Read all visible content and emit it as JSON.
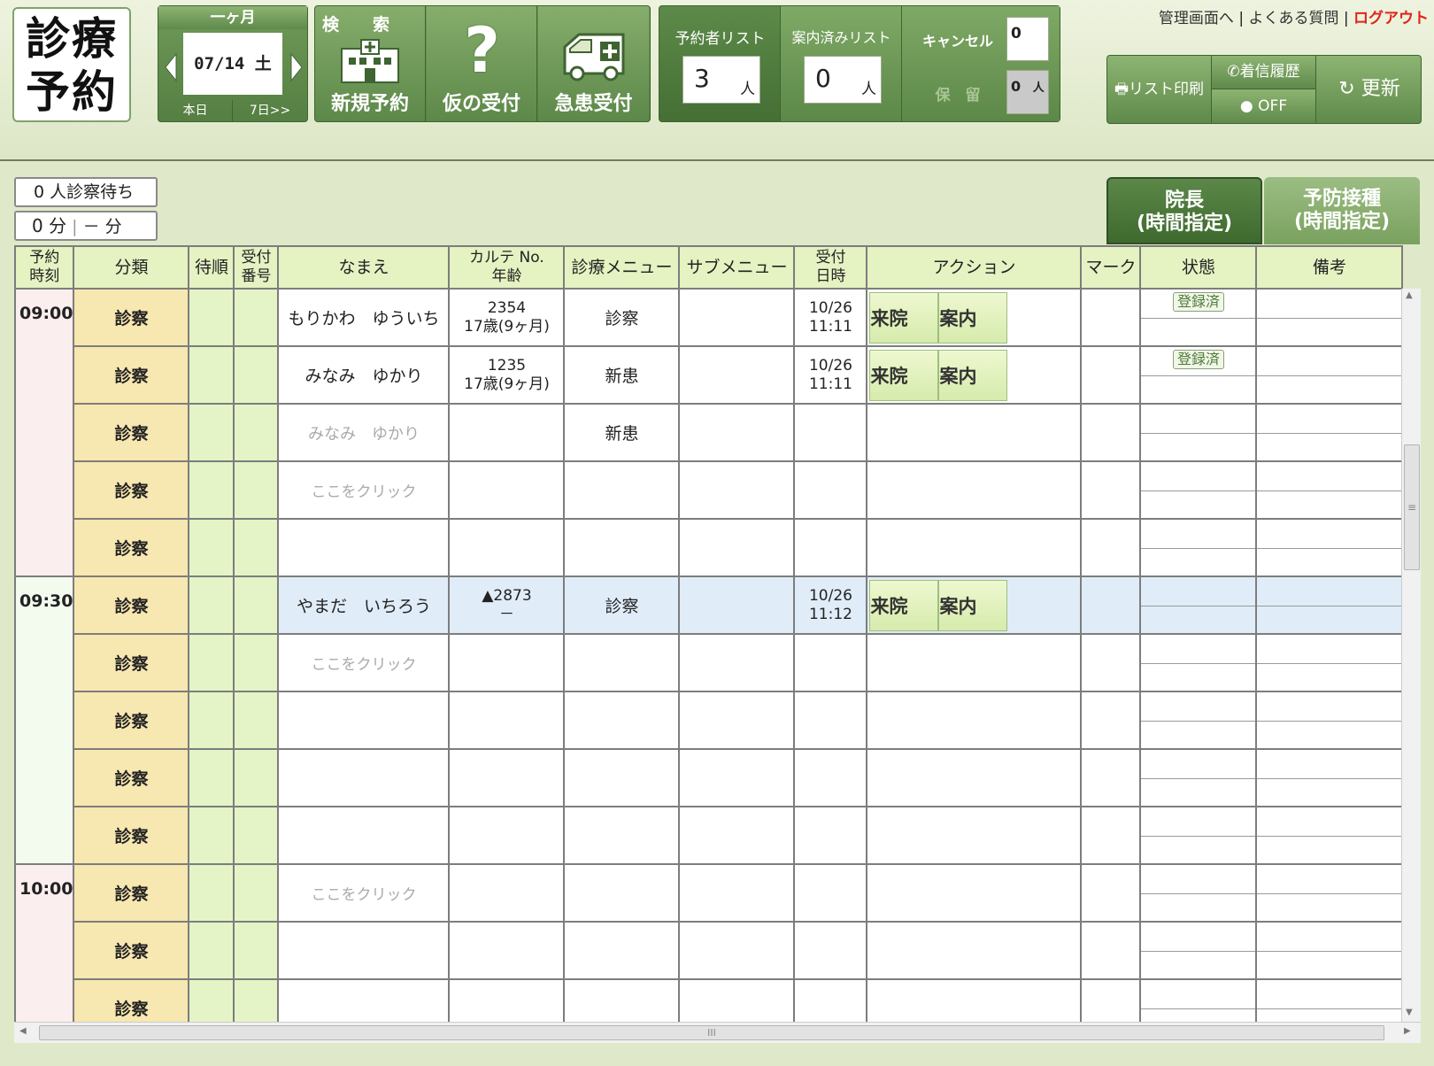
{
  "logo": {
    "line1": "診療",
    "line2": "予約"
  },
  "date_nav": {
    "month_label": "一ヶ月",
    "date": "07/14 土",
    "today": "本日",
    "next7": "7日>>",
    "prev_icon": "triangle-left-icon",
    "next_icon": "triangle-right-icon"
  },
  "buttons": {
    "search_top": "検　　索",
    "new": "新規予約",
    "temp": "仮の受付",
    "emergency": "急患受付"
  },
  "lists": {
    "reserved_label": "予約者リスト",
    "reserved_count": "3",
    "reserved_unit": "人",
    "guided_label": "案内済みリスト",
    "guided_count": "0",
    "guided_unit": "人",
    "cancel_label": "キャンセル",
    "cancel_count": "0",
    "hold_label": "保　留",
    "hold_count": "0",
    "hold_unit": "人"
  },
  "links": {
    "admin": "管理画面へ",
    "faq": "よくある質問",
    "logout": "ログアウト",
    "sep": "|"
  },
  "tools": {
    "print": "リスト印刷",
    "call_history": "着信履歴",
    "off": "OFF",
    "refresh": "更新"
  },
  "status": {
    "waiting": "0 人診察待ち",
    "minutes": "0 分",
    "dash_min": "－ 分"
  },
  "tabs": [
    {
      "label1": "院長",
      "label2": "(時間指定)"
    },
    {
      "label1": "予防接種",
      "label2": "(時間指定)"
    }
  ],
  "columns": {
    "time": [
      "予約",
      "時刻"
    ],
    "category": "分類",
    "order": "待順",
    "recept": [
      "受付",
      "番号"
    ],
    "name": "なまえ",
    "karte": [
      "カルテ No.",
      "年齢"
    ],
    "menu": "診療メニュー",
    "submenu": "サブメニュー",
    "recept_dt": [
      "受付",
      "日時"
    ],
    "action": "アクション",
    "mark": "マーク",
    "state": "状態",
    "note": "備考"
  },
  "actions": {
    "arrive": "来院",
    "guide": "案内"
  },
  "badge": "登録済",
  "rows": [
    {
      "time": "09:00",
      "cat": "診察",
      "name": "もりかわ　ゆういち",
      "karte": "2354",
      "age": "17歳(9ヶ月)",
      "menu": "診察",
      "date": "10/26",
      "clock": "11:11"
    },
    {
      "cat": "診察",
      "name": "みなみ　ゆかり",
      "karte": "1235",
      "age": "17歳(9ヶ月)",
      "menu": "新患",
      "date": "10/26",
      "clock": "11:11"
    },
    {
      "cat": "診察",
      "name": "みなみ　ゆかり",
      "menu": "新患"
    },
    {
      "cat": "診察",
      "name": "ここをクリック"
    },
    {
      "cat": "診察"
    },
    {
      "time": "09:30",
      "cat": "診察",
      "name": "やまだ　いちろう",
      "karte": "▲2873",
      "age": "－",
      "menu": "診察",
      "date": "10/26",
      "clock": "11:12"
    },
    {
      "cat": "診察",
      "name": "ここをクリック"
    },
    {
      "cat": "診察"
    },
    {
      "cat": "診察"
    },
    {
      "cat": "診察"
    },
    {
      "time": "10:00",
      "cat": "診察",
      "name": "ここをクリック"
    },
    {
      "cat": "診察"
    },
    {
      "cat": "診察"
    }
  ],
  "scroll": {
    "up": "▲",
    "down": "▼",
    "left": "◀",
    "right": "▶",
    "grip": "≡",
    "hgrip": "III"
  }
}
